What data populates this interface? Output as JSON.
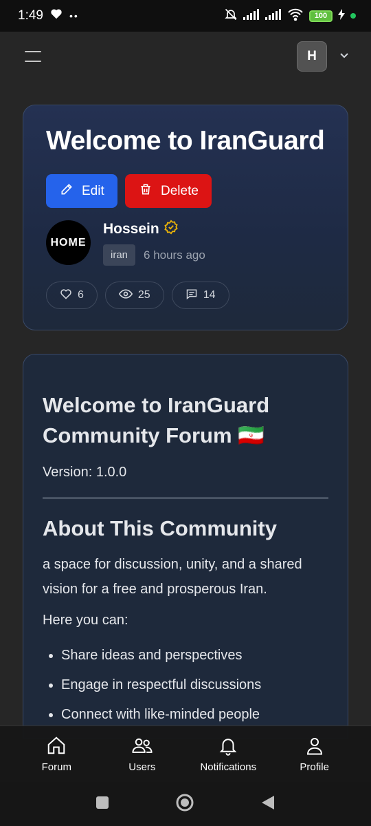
{
  "status_bar": {
    "time": "1:49",
    "battery": "100"
  },
  "header": {
    "user_initial": "H"
  },
  "post": {
    "title": "Welcome to IranGuard",
    "edit_label": "Edit",
    "delete_label": "Delete",
    "author": "Hossein",
    "avatar_text": "HOME",
    "tag": "iran",
    "time_ago": "6 hours ago",
    "likes": "6",
    "views": "25",
    "comments": "14"
  },
  "content": {
    "heading": "Welcome to IranGuard Community Forum 🇮🇷",
    "version": "Version: 1.0.0",
    "about_heading": "About This Community",
    "about_text": "a space for discussion, unity, and a shared vision for a free and prosperous Iran.",
    "here_you_can": "Here you can:",
    "items": [
      "Share ideas and perspectives",
      "Engage in respectful discussions",
      "Connect with like-minded people"
    ]
  },
  "bottom_nav": [
    {
      "label": "Forum",
      "icon": "home-icon"
    },
    {
      "label": "Users",
      "icon": "users-icon"
    },
    {
      "label": "Notifications",
      "icon": "bell-icon"
    },
    {
      "label": "Profile",
      "icon": "profile-icon"
    }
  ],
  "colors": {
    "edit": "#2563eb",
    "delete": "#dc1414",
    "card_bg": "#1e293b",
    "verified": "#eab308"
  }
}
